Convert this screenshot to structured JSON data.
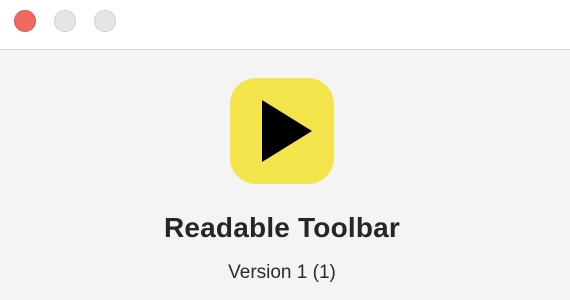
{
  "window": {
    "controls": [
      {
        "name": "close",
        "color": "#ee6a5f"
      },
      {
        "name": "minimize",
        "color": "#e6e6e6"
      },
      {
        "name": "zoom",
        "color": "#e6e6e6"
      }
    ]
  },
  "about": {
    "icon": "play-icon",
    "icon_color": "#f3e44c",
    "app_name": "Readable Toolbar",
    "version": "Version 1 (1)"
  }
}
